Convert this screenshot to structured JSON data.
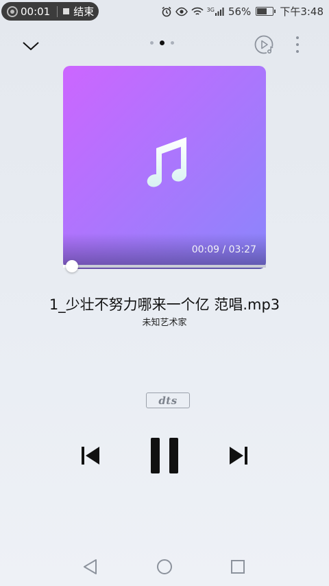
{
  "status_bar": {
    "record_time": "00:01",
    "end_label": "结束",
    "signal_label": "3G",
    "battery_percent": "56%",
    "battery_level": 0.56,
    "clock": "下午3:48"
  },
  "top_bar": {
    "page_count": 3,
    "active_page": 2
  },
  "player": {
    "time_display": "00:09 / 03:27",
    "elapsed_seconds": 9,
    "duration_seconds": 207,
    "title": "1_少壮不努力哪来一个亿 范唱.mp3",
    "artist": "未知艺术家",
    "dts_label": "dts"
  },
  "colors": {
    "album_gradient_start": "#cc66ff",
    "album_gradient_end": "#8a86fb"
  },
  "icons": {
    "collapse": "chevron-down-icon",
    "playlist": "playlist-icon",
    "more": "more-vertical-icon",
    "album_art": "music-note-icon",
    "previous": "skip-previous-icon",
    "play_state": "pause-icon",
    "next": "skip-next-icon",
    "nav_back": "nav-back-icon",
    "nav_home": "nav-home-icon",
    "nav_recents": "nav-recents-icon"
  }
}
